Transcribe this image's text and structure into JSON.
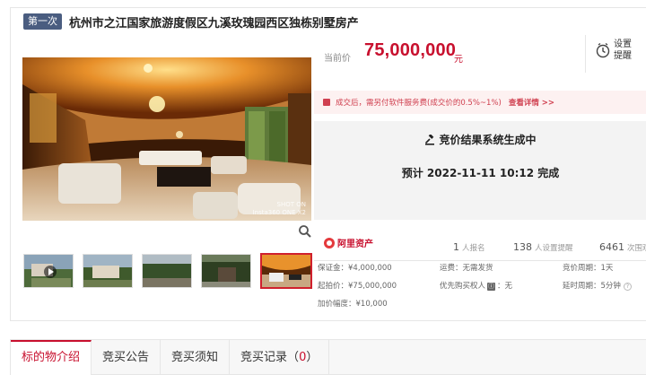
{
  "header": {
    "badge": "第一次",
    "title": "杭州市之江国家旅游度假区九溪玫瑰园西区独栋别墅房产"
  },
  "gallery": {
    "watermark_line1": "SHOT ON",
    "watermark_line2": "Insta360 ONE X2"
  },
  "price": {
    "label": "当前价",
    "value": "75,000,000",
    "unit": "元"
  },
  "remind": {
    "label": "设置提醒"
  },
  "notice": {
    "text": "成交后，需另付软件服务费(成交价的0.5%~1%)",
    "link": "查看详情 >>"
  },
  "result": {
    "title": "竞价结果系统生成中",
    "time": "预计 2022-11-11 10:12 完成"
  },
  "stats": {
    "brand": "阿里资产",
    "signup_count": "1",
    "signup_label": "人报名",
    "remind_count": "138",
    "remind_label": "人设置提醒",
    "view_count": "6461",
    "view_label": "次围观"
  },
  "details": {
    "deposit": "保证金：¥4,000,000",
    "start_price": "起拍价：¥75,000,000",
    "increment": "加价幅度：¥10,000",
    "shipping": "运费：无需发货",
    "priority_label": "优先购买权人",
    "priority_badge": "ⓘ",
    "priority_value": "：无",
    "cycle": "竞价周期：1天",
    "delay": "延时周期：5分钟",
    "help": "?"
  },
  "tabs": [
    {
      "label": "标的物介绍"
    },
    {
      "label": "竞买公告"
    },
    {
      "label": "竞买须知"
    },
    {
      "label": "竞买记录（",
      "count": "0",
      "suffix": "）"
    }
  ],
  "colors": {
    "accent": "#c8102e",
    "badge": "#4a5d80",
    "notice_bg": "#fdf1f1"
  }
}
